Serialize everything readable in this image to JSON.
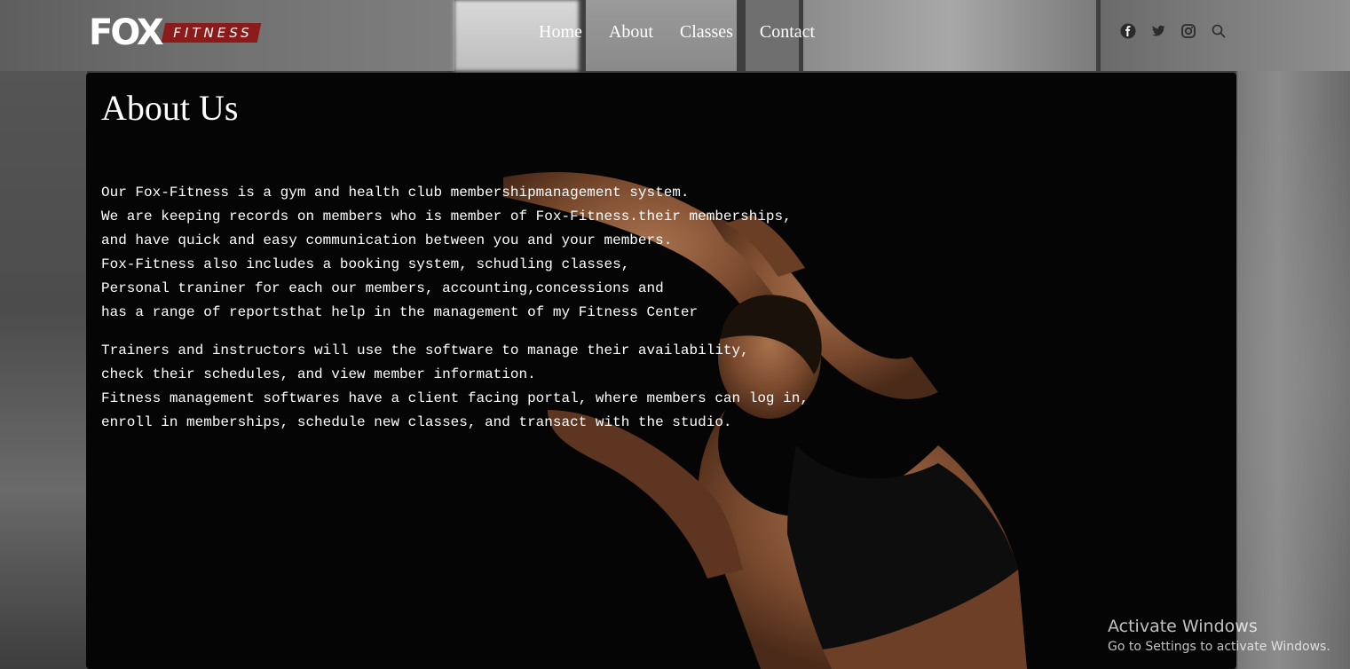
{
  "header": {
    "logo": {
      "brand_mark": "FOX",
      "brand_word": "FITNESS"
    },
    "nav": [
      {
        "label": "Home"
      },
      {
        "label": "About"
      },
      {
        "label": "Classes"
      },
      {
        "label": "Contact"
      }
    ],
    "social_icons": [
      "facebook-icon",
      "twitter-icon",
      "instagram-icon",
      "search-icon"
    ]
  },
  "main": {
    "title": "About Us",
    "paragraph1": [
      "Our Fox-Fitness is a gym and health club membershipmanagement system.",
      "We are keeping records on members who is member of Fox-Fitness.their memberships,",
      "and have quick and easy communication between you and your members.",
      "Fox-Fitness also includes a booking system, schudling classes,",
      "Personal traniner for each our members, accounting,concessions and",
      "has a range of reportsthat help in the management of my Fitness Center"
    ],
    "paragraph2": [
      "Trainers and instructors will use the software to manage their availability,",
      "check their schedules, and view member information.",
      "Fitness management softwares have a client facing portal, where members can log in,",
      "enroll in memberships, schedule new classes, and transact with the studio."
    ]
  },
  "watermark": {
    "title": "Activate Windows",
    "subtitle": "Go to Settings to activate Windows."
  },
  "colors": {
    "accent": "#8b1a1a",
    "panel": "#050505",
    "text": "#ffffff"
  }
}
